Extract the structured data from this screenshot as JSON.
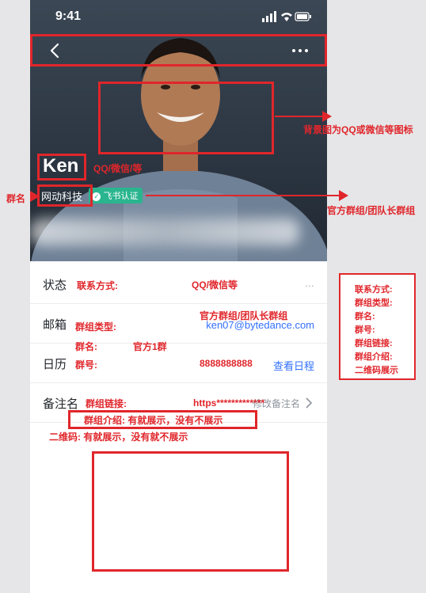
{
  "status_bar": {
    "time": "9:41"
  },
  "profile": {
    "name": "Ken",
    "organization": "网动科技",
    "certification": "飞书认证"
  },
  "rows": [
    {
      "label": "状态",
      "value": "…",
      "annotation_left": "联系方式:",
      "annotation_right": "QQ/微信等"
    },
    {
      "label": "邮箱",
      "value": "ken07@bytedance.com",
      "annotation_left": "群组类型:",
      "annotation_right": "官方群组/团队长群组"
    },
    {
      "label": "日历",
      "value": "查看日程",
      "annotation_left": "群号:",
      "annotation_right": "8888888888"
    },
    {
      "label": "备注名",
      "value": "修改备注名",
      "annotation_left": "群组链接:",
      "annotation_right": "https*************"
    }
  ],
  "annotations": {
    "background_note": "背景图为QQ或微信等图标",
    "name_note": "QQ/微信/等",
    "group_name_label": "群名",
    "group_name_row": "群名:",
    "group_name_value": "官方1群",
    "official_group_note": "官方群组/团队长群组",
    "intro_note": "群组介绍:   有就展示，没有不展示",
    "qr_note": "二维码:      有就展示，没有就不展示",
    "side_items": [
      "联系方式:",
      "群组类型:",
      "群名:",
      "群号:",
      "群组链接:",
      "群组介绍:",
      "二维码展示"
    ]
  },
  "colors": {
    "annotation": "#e0262b",
    "link": "#3370ff",
    "badge": "#2ab58f"
  }
}
